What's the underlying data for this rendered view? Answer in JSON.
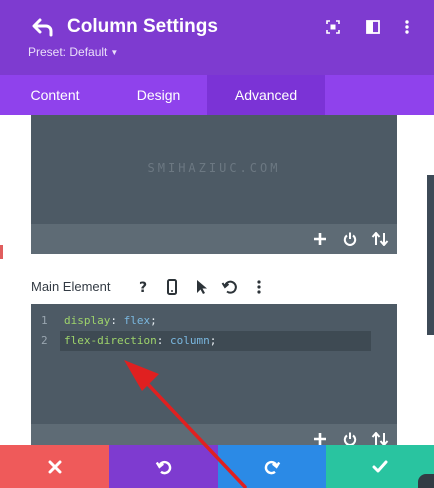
{
  "header": {
    "title": "Column Settings",
    "preset": "Preset: Default",
    "icons": [
      "back-arrow-icon",
      "focus-expand-icon",
      "sidebar-layout-icon",
      "more-vertical-icon"
    ]
  },
  "tabs": [
    {
      "label": "Content",
      "active": false
    },
    {
      "label": "Design",
      "active": false
    },
    {
      "label": "Advanced",
      "active": true
    }
  ],
  "editor_top": {
    "watermark": "SMIHAZIUC.COM",
    "toolbar_icons": [
      "plus-icon",
      "power-icon",
      "sort-arrows-icon"
    ]
  },
  "main_element": {
    "label": "Main Element",
    "label_icons": [
      "help-icon",
      "mobile-icon",
      "cursor-icon",
      "undo-icon",
      "more-vertical-icon"
    ],
    "lines": [
      {
        "num": "1",
        "property": "display",
        "value": "flex"
      },
      {
        "num": "2",
        "property": "flex-direction",
        "value": "column"
      }
    ],
    "toolbar_icons": [
      "plus-icon",
      "power-icon",
      "sort-arrows-icon"
    ]
  },
  "footer": {
    "buttons": [
      {
        "name": "cancel",
        "icon": "close-icon",
        "color": "#ef5a5a"
      },
      {
        "name": "undo",
        "icon": "undo-icon",
        "color": "#7e3bd0"
      },
      {
        "name": "redo",
        "icon": "redo-icon",
        "color": "#2b8ae6"
      },
      {
        "name": "save",
        "icon": "check-icon",
        "color": "#29c4a0"
      }
    ]
  },
  "colors": {
    "header": "#7e3bd0",
    "tabs": "#8f42ec",
    "tab_active": "#7b33d6",
    "editor": "#4d5a65",
    "annotation_arrow": "#e02020"
  }
}
